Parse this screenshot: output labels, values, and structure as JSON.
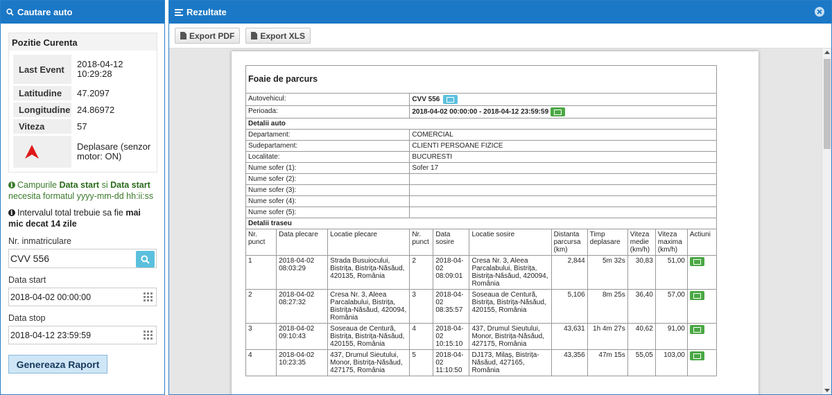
{
  "left": {
    "title": "Cautare auto",
    "position": {
      "title": "Pozitie Curenta",
      "rows": [
        {
          "label": "Last Event",
          "value": "2018-04-12 10:29:28"
        },
        {
          "label": "Latitudine",
          "value": "47.2097"
        },
        {
          "label": "Longitudine",
          "value": "24.86972"
        },
        {
          "label": "Viteza",
          "value": "57"
        }
      ],
      "status": "Deplasare (senzor motor: ON)"
    },
    "note1": {
      "p1": "Campurile ",
      "b1": "Data start",
      "p2": " si ",
      "b2": "Data start",
      "p3": " necesita formatul yyyy-mm-dd hh:ii:ss"
    },
    "note2": {
      "p1": "Intervalul total trebuie sa fie ",
      "b1": "mai mic decat 14 zile"
    },
    "plate_label": "Nr. inmatriculare",
    "plate_value": "CVV 556",
    "start_label": "Data start",
    "start_value": "2018-04-02 00:00:00",
    "stop_label": "Data stop",
    "stop_value": "2018-04-12 23:59:59",
    "generate_button": "Genereaza Raport"
  },
  "right": {
    "title": "Rezultate",
    "export_pdf": "Export PDF",
    "export_xls": "Export XLS",
    "report": {
      "title": "Foaie de parcurs",
      "vehicle_label": "Autovehicul:",
      "vehicle_value": "CVV 556",
      "period_label": "Perioada:",
      "period_value": "2018-04-02 00:00:00 - 2018-04-12 23:59:59",
      "auto_section": "Detalii auto",
      "auto_rows": [
        {
          "label": "Departament:",
          "value": "COMERCIAL"
        },
        {
          "label": "Sudepartament:",
          "value": "CLIENTI PERSOANE FIZICE"
        },
        {
          "label": "Localitate:",
          "value": "BUCURESTI"
        },
        {
          "label": "Nume sofer (1):",
          "value": "Sofer 17"
        },
        {
          "label": "Nume sofer (2):",
          "value": ""
        },
        {
          "label": "Nume sofer (3):",
          "value": ""
        },
        {
          "label": "Nume sofer (4):",
          "value": ""
        },
        {
          "label": "Nume sofer (5):",
          "value": ""
        }
      ],
      "route_section": "Detalii traseu",
      "columns": [
        "Nr. punct",
        "Data plecare",
        "Locatie plecare",
        "Nr. punct",
        "Data sosire",
        "Locatie sosire",
        "Distanta parcursa (km)",
        "Timp deplasare",
        "Viteza medie (km/h)",
        "Viteza maxima (km/h)",
        "Actiuni"
      ],
      "rows": [
        {
          "n1": "1",
          "d1": "2018-04-02 08:03:29",
          "l1": "Strada Busuiocului, Bistrița, Bistrița-Năsăud, 420135, România",
          "n2": "2",
          "d2": "2018-04-02 08:09:01",
          "l2": "Cresa Nr. 3, Aleea Parcalabului, Bistrița, Bistrița-Năsăud, 420094, România",
          "dist": "2,844",
          "time": "5m 32s",
          "avg": "30,83",
          "max": "51,00"
        },
        {
          "n1": "2",
          "d1": "2018-04-02 08:27:32",
          "l1": "Cresa Nr. 3, Aleea Parcalabului, Bistrița, Bistrița-Năsăud, 420094, România",
          "n2": "3",
          "d2": "2018-04-02 08:35:57",
          "l2": "Soseaua de Centură, Bistrița, Bistrița-Năsăud, 420155, România",
          "dist": "5,106",
          "time": "8m 25s",
          "avg": "36,40",
          "max": "57,00"
        },
        {
          "n1": "3",
          "d1": "2018-04-02 09:10:43",
          "l1": "Soseaua de Centură, Bistrița, Bistrița-Năsăud, 420155, România",
          "n2": "4",
          "d2": "2018-04-02 10:15:10",
          "l2": "437, Drumul Sieutului, Monor, Bistrița-Năsăud, 427175, România",
          "dist": "43,631",
          "time": "1h 4m 27s",
          "avg": "40,62",
          "max": "91,00"
        },
        {
          "n1": "4",
          "d1": "2018-04-02 10:23:35",
          "l1": "437, Drumul Sieutului, Monor, Bistrița-Năsăud, 427175, România",
          "n2": "5",
          "d2": "2018-04-02 11:10:50",
          "l2": "DJ173, Milaș, Bistrița-Năsăud, 427165, România",
          "dist": "43,356",
          "time": "47m 15s",
          "avg": "55,05",
          "max": "103,00"
        }
      ]
    }
  }
}
